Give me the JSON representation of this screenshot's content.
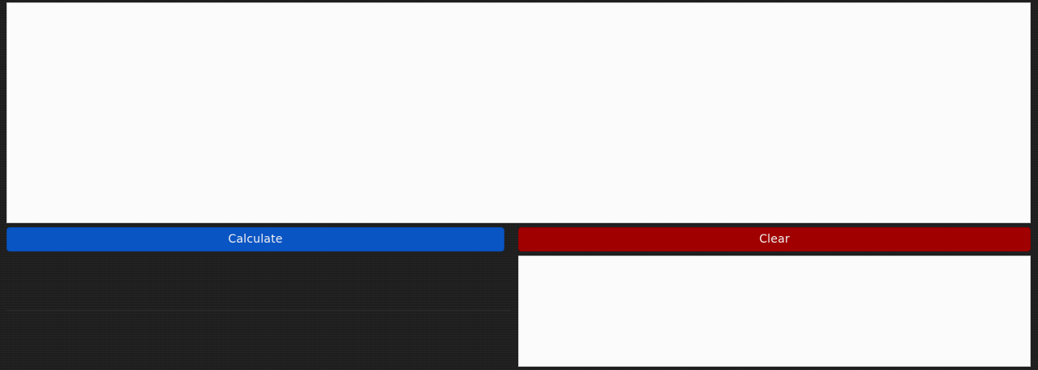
{
  "buttons": {
    "calculate_label": "Calculate",
    "clear_label": "Clear"
  },
  "input": {
    "value": ""
  },
  "output": {
    "value": ""
  },
  "colors": {
    "calculate": "#0a55c4",
    "clear": "#a00000",
    "background": "#1f1f1f",
    "panel": "#fbfbfb"
  }
}
